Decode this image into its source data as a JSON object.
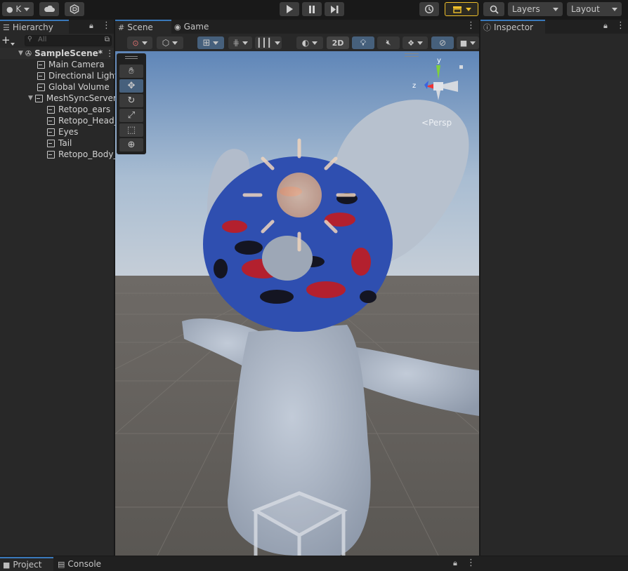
{
  "toolbar": {
    "account_label": "K",
    "layers_label": "Layers",
    "layout_label": "Layout",
    "icons": [
      "account-icon",
      "cloud-icon",
      "collab-icon",
      "play-icon",
      "pause-icon",
      "step-icon",
      "history-icon",
      "store-icon",
      "search-icon"
    ]
  },
  "hierarchy": {
    "tab_label": "Hierarchy",
    "search_placeholder": "All",
    "scene_name": "SampleScene*",
    "items": [
      {
        "label": "Main Camera"
      },
      {
        "label": "Directional Light"
      },
      {
        "label": "Global Volume"
      },
      {
        "label": "MeshSyncServer"
      },
      {
        "label": "Retopo_ears"
      },
      {
        "label": "Retopo_Head_"
      },
      {
        "label": "Eyes"
      },
      {
        "label": "Tail"
      },
      {
        "label": "Retopo_Body_"
      }
    ]
  },
  "scene_view": {
    "scene_tab_label": "Scene",
    "game_tab_label": "Game",
    "mode_2d_label": "2D",
    "persp_label": "Persp",
    "gizmo_axes": {
      "x": "x",
      "y": "y",
      "z": "z"
    }
  },
  "inspector": {
    "tab_label": "Inspector"
  },
  "bottom": {
    "project_tab_label": "Project",
    "console_tab_label": "Console"
  },
  "colors": {
    "accent_blue": "#3a79bb",
    "active_button": "#46607c",
    "store_button_border": "#f0c02a"
  }
}
